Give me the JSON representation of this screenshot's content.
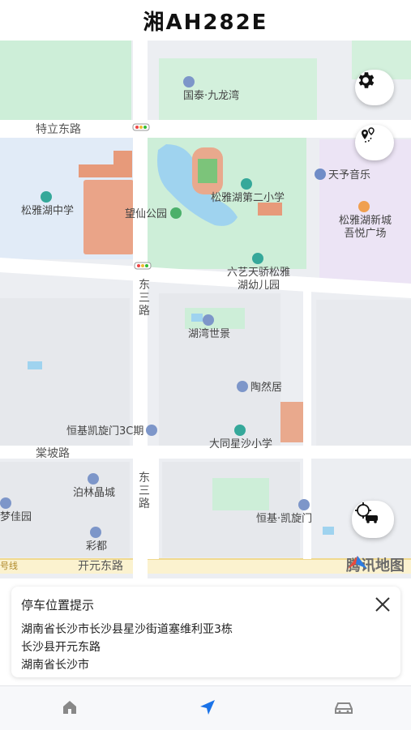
{
  "header": {
    "title": "湘AH282E"
  },
  "map": {
    "road_labels": {
      "telidong": "特立东路",
      "dongsan_v": [
        "东",
        "三",
        "路"
      ],
      "dongsan_v2": [
        "东",
        "三",
        "路"
      ],
      "tangpo": "棠坡路",
      "kaiyuandong": "开元东路",
      "haoxian": "号线"
    },
    "pois": {
      "guotai": "国泰·九龙湾",
      "songyahu_middle": "松雅湖中学",
      "wangxian_park": "望仙公园",
      "songya_school2": "松雅湖第二小学",
      "tianyu_music": "天予音乐",
      "songya_newtown_1": "松雅湖新城",
      "songya_newtown_2": "吾悦广场",
      "liuyi_1": "六艺天骄松雅",
      "liuyi_2": "湖幼儿园",
      "huwan": "湖湾世景",
      "taoran": "陶然居",
      "hengji_3c": "恒基凯旋门3C期",
      "datong_school": "大同星沙小学",
      "bolin": "泊林晶城",
      "mengjia": "梦佳园",
      "caidu": "彩都",
      "hengji_kaixuan": "恒基·凯旋门"
    },
    "watermark": "腾讯地图",
    "buttons": {
      "settings": "gear-icon",
      "route": "route-pin-icon",
      "locate_car": "locate-car-icon"
    }
  },
  "card": {
    "title": "停车位置提示",
    "lines": [
      "湖南省长沙市长沙县星沙街道塞维利亚3栋",
      "长沙县开元东路",
      "湖南省长沙市"
    ]
  },
  "tabbar": {
    "items": [
      "home-icon",
      "navigate-icon",
      "car-icon"
    ],
    "active_color": "#1a73e8",
    "inactive_color": "#888888"
  }
}
